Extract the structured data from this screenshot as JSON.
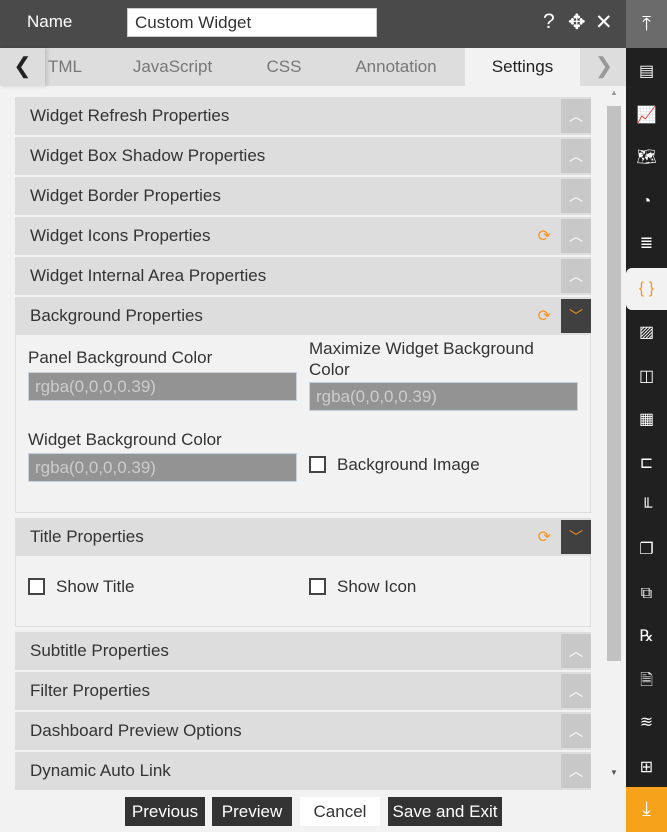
{
  "header": {
    "name_label": "Name",
    "name_value": "Custom Widget",
    "help_icon": "?",
    "move_icon": "✥",
    "close_icon": "✕"
  },
  "tabs": [
    {
      "label": "TML"
    },
    {
      "label": "JavaScript"
    },
    {
      "label": "CSS"
    },
    {
      "label": "Annotation"
    },
    {
      "label": "Settings",
      "active": true
    }
  ],
  "sections": {
    "refresh": "Widget Refresh Properties",
    "shadow": "Widget Box Shadow Properties",
    "border": "Widget Border Properties",
    "icons": "Widget Icons Properties",
    "internal": "Widget Internal Area Properties",
    "background": "Background Properties",
    "title": "Title Properties",
    "subtitle": "Subtitle Properties",
    "filter": "Filter Properties",
    "preview": "Dashboard Preview Options",
    "autolink": "Dynamic Auto Link"
  },
  "background": {
    "panel_label": "Panel Background Color",
    "panel_value": "rgba(0,0,0,0.39)",
    "maximize_label": "Maximize Widget Background Color",
    "maximize_value": "rgba(0,0,0,0.39)",
    "widget_label": "Widget Background Color",
    "widget_value": "rgba(0,0,0,0.39)",
    "image_label": "Background Image"
  },
  "title_props": {
    "show_title": "Show Title",
    "show_icon": "Show Icon"
  },
  "footer": {
    "previous": "Previous",
    "preview": "Preview",
    "cancel": "Cancel",
    "save": "Save and Exit"
  },
  "colors": {
    "accent": "#f7941d",
    "header": "#4a4a4a",
    "sidebar": "#202020"
  }
}
